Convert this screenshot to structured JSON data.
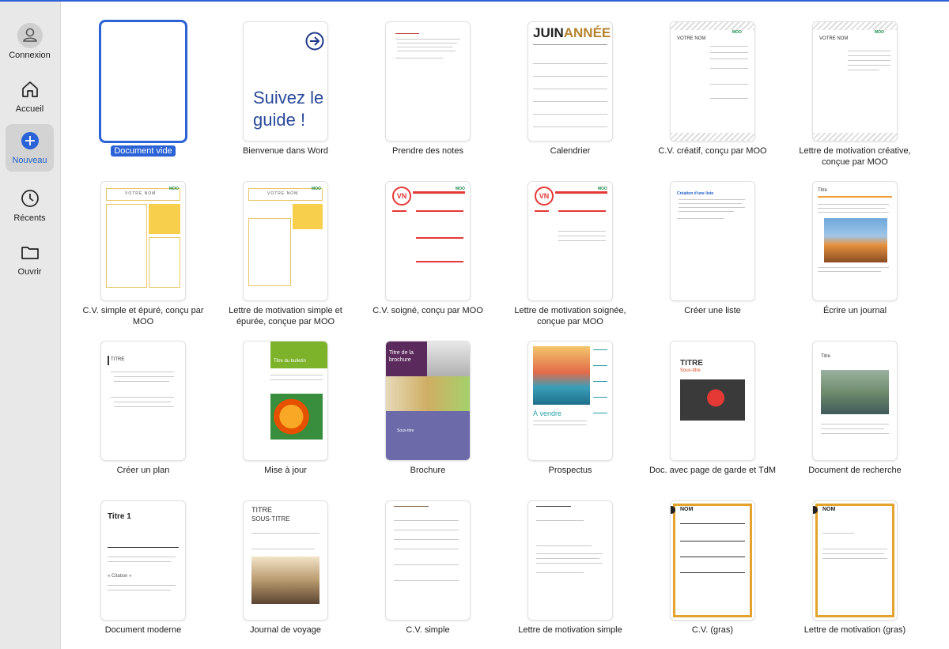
{
  "sidebar": {
    "items": [
      {
        "label": "Connexion",
        "icon": "account-icon"
      },
      {
        "label": "Accueil",
        "icon": "home-icon"
      },
      {
        "label": "Nouveau",
        "icon": "new-plus-icon"
      },
      {
        "label": "Récents",
        "icon": "clock-icon"
      },
      {
        "label": "Ouvrir",
        "icon": "folder-icon"
      }
    ],
    "active": "Nouveau",
    "accent": "#2b62d6"
  },
  "templates": [
    {
      "label": "Document vide"
    },
    {
      "label": "Bienvenue dans Word",
      "thumb_text": "Suivez le guide !"
    },
    {
      "label": "Prendre des notes"
    },
    {
      "label": "Calendrier",
      "thumb_text_a": "JUIN",
      "thumb_text_b": "ANNÉE"
    },
    {
      "label": "C.V. créatif, conçu par MOO",
      "thumb_text": "VOTRE NOM",
      "brand": "MOO"
    },
    {
      "label": "Lettre de motivation créative, conçue par MOO",
      "thumb_text": "VOTRE NOM",
      "brand": "MOO"
    },
    {
      "label": "C.V. simple et épuré, conçu par MOO",
      "thumb_text": "VOTRE NOM",
      "brand": "MOO"
    },
    {
      "label": "Lettre de motivation simple et épurée, conçue par MOO",
      "thumb_text": "VOTRE NOM",
      "brand": "MOO"
    },
    {
      "label": "C.V. soigné, conçu par MOO",
      "thumb_text": "VN",
      "brand": "MOO"
    },
    {
      "label": "Lettre de motivation soignée, conçue par MOO",
      "thumb_text": "VN",
      "brand": "MOO"
    },
    {
      "label": "Créer une liste",
      "thumb_text": "Création d'une liste"
    },
    {
      "label": "Écrire un journal",
      "thumb_text": "Titre"
    },
    {
      "label": "Créer un plan",
      "thumb_text": "TITRE"
    },
    {
      "label": "Mise à jour",
      "thumb_text": "Titre du bulletin"
    },
    {
      "label": "Brochure",
      "thumb_text": "Titre de la brochure",
      "thumb_text_b": "Sous-titre"
    },
    {
      "label": "Prospectus",
      "thumb_text": "À vendre"
    },
    {
      "label": "Doc. avec page de garde et TdM",
      "thumb_text": "TITRE",
      "thumb_text_b": "Sous-titre"
    },
    {
      "label": "Document de recherche",
      "thumb_text": "Titre"
    },
    {
      "label": "Document moderne",
      "thumb_text": "Titre 1",
      "thumb_text_b": "« Citation »"
    },
    {
      "label": "Journal de voyage",
      "thumb_text": "TITRE",
      "thumb_text_b": "SOUS-TITRE"
    },
    {
      "label": "C.V. simple"
    },
    {
      "label": "Lettre de motivation simple"
    },
    {
      "label": "C.V. (gras)",
      "thumb_text": "NOM"
    },
    {
      "label": "Lettre de motivation (gras)",
      "thumb_text": "NOM"
    }
  ]
}
